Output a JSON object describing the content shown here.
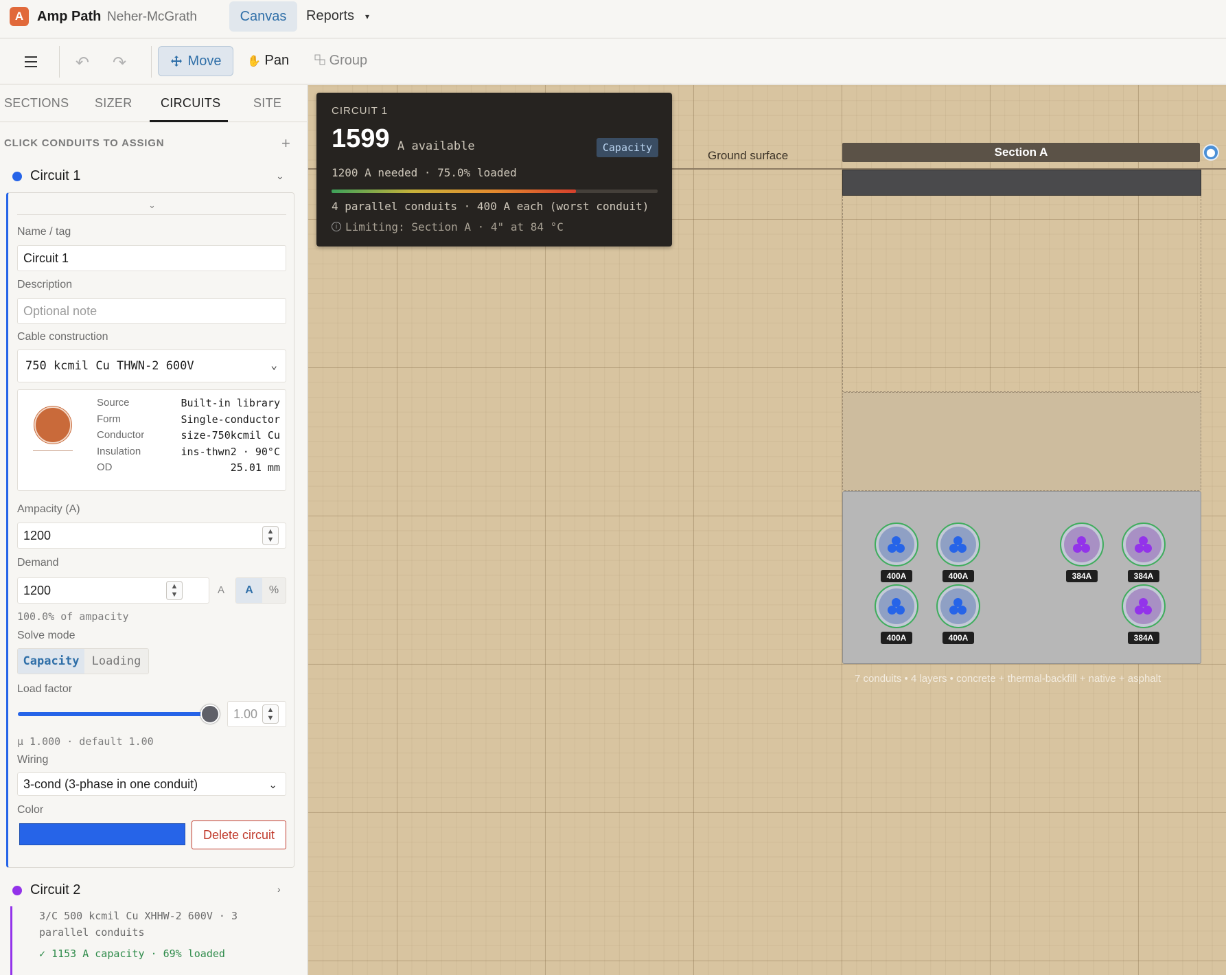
{
  "app": {
    "logo_letter": "A",
    "name": "Amp Path",
    "project": "Neher-McGrath",
    "tabs": [
      {
        "label": "Canvas",
        "active": true
      },
      {
        "label": "Reports",
        "caret": "▾"
      }
    ]
  },
  "toolbar": {
    "menu_icon": "hamburger-icon",
    "undo_icon": "undo-icon",
    "redo_icon": "redo-icon",
    "move_label": "Move",
    "pan_label": "Pan",
    "group_label": "Group",
    "active_tool": "Move"
  },
  "sidebar": {
    "tabs": [
      "SECTIONS",
      "SIZER",
      "CIRCUITS",
      "SITE"
    ],
    "active_tab": "CIRCUITS",
    "assign_hint": "CLICK CONDUITS TO ASSIGN",
    "add_label": "+",
    "circuit1": {
      "name": "Circuit 1",
      "color": "#2664e8",
      "labels": {
        "name_tag": "Name / tag",
        "description": "Description",
        "cable": "Cable construction",
        "ampacity": "Ampacity (A)",
        "demand": "Demand",
        "solve_mode": "Solve mode",
        "load_factor": "Load factor",
        "wiring": "Wiring",
        "color": "Color"
      },
      "name_value": "Circuit 1",
      "description_placeholder": "Optional note",
      "cable_value": "750 kcmil Cu THWN-2 600V",
      "cable_specs": [
        {
          "key": "Source",
          "value": "Built-in library"
        },
        {
          "key": "Form",
          "value": "Single-conductor"
        },
        {
          "key": "Conductor",
          "value": "size-750kcmil Cu"
        },
        {
          "key": "Insulation",
          "value": "ins-thwn2 · 90°C"
        },
        {
          "key": "OD",
          "value": "25.01 mm"
        }
      ],
      "ampacity_value": "1200",
      "demand_value": "1200",
      "demand_unit_plain": "A",
      "unit_options": [
        "A",
        "%"
      ],
      "unit_selected": "A",
      "pct_of_ampacity": "100.0% of ampacity",
      "solve_options": [
        "Capacity",
        "Loading"
      ],
      "solve_selected": "Capacity",
      "load_factor_value": "1.00",
      "load_factor_level": 1.0,
      "mu_text": "μ 1.000 · default 1.00",
      "wiring_value": "3-cond (3-phase in one conduit)",
      "delete_label": "Delete circuit"
    },
    "circuit2": {
      "name": "Circuit 2",
      "color": "#9333ea",
      "description": "3/C 500 kcmil Cu XHHW-2 600V · 3 parallel conduits",
      "status": "✓ 1153 A capacity · 69% loaded"
    }
  },
  "canvas": {
    "ground_label": "Ground surface",
    "section_title": "Section A",
    "pin_icon": "location-pin-icon",
    "conduit_tags": {
      "c1r1a": "400A",
      "c1r1b": "400A",
      "c1r2a": "400A",
      "c1r2b": "400A",
      "c2r1a": "384A",
      "c2r1b": "384A",
      "c2r2b": "384A"
    },
    "summary": "7 conduits • 4 layers • concrete + thermal-backfill + native + asphalt",
    "info_card": {
      "title": "CIRCUIT 1",
      "available_value": "1599",
      "available_unit": "A available",
      "badge": "Capacity",
      "needed_line": "1200 A needed · 75.0% loaded",
      "loaded_fraction": 0.75,
      "parallel_line": "4 parallel conduits · 400 A each (worst conduit)",
      "limiting_line": "Limiting: Section A · 4\" at 84 °C"
    }
  }
}
